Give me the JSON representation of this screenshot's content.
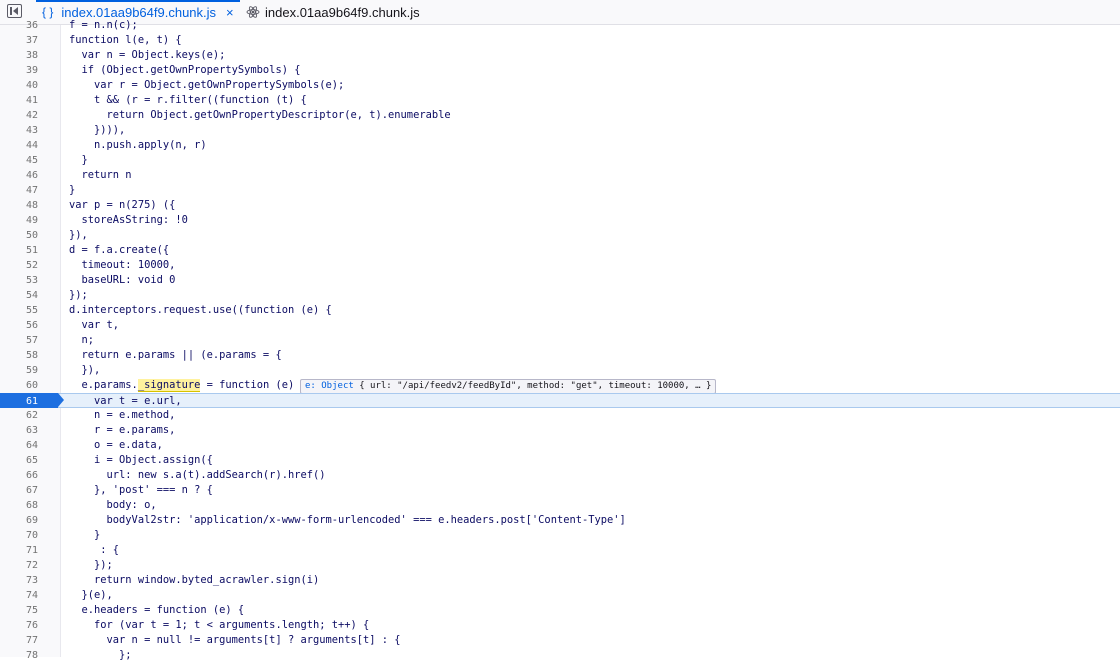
{
  "tabs": [
    {
      "label": "index.01aa9b64f9.chunk.js",
      "icon": "braces-icon",
      "active": true,
      "close": "×"
    },
    {
      "label": "index.01aa9b64f9.chunk.js",
      "icon": "react-icon",
      "active": false
    }
  ],
  "braces_glyph": "{ }",
  "paused_line": "61",
  "preview": {
    "param": "e:",
    "type": "Object",
    "body": "{ url: \"/api/feedv2/feedById\", method: \"get\", timeout: 10000, … }"
  },
  "lines": [
    {
      "n": "36",
      "code": "f = n.n(c);"
    },
    {
      "n": "37",
      "code": "function l(e, t) {"
    },
    {
      "n": "38",
      "code": "  var n = Object.keys(e);"
    },
    {
      "n": "39",
      "code": "  if (Object.getOwnPropertySymbols) {"
    },
    {
      "n": "40",
      "code": "    var r = Object.getOwnPropertySymbols(e);"
    },
    {
      "n": "41",
      "code": "    t && (r = r.filter((function (t) {"
    },
    {
      "n": "42",
      "code": "      return Object.getOwnPropertyDescriptor(e, t).enumerable"
    },
    {
      "n": "43",
      "code": "    }))),"
    },
    {
      "n": "44",
      "code": "    n.push.apply(n, r)"
    },
    {
      "n": "45",
      "code": "  }"
    },
    {
      "n": "46",
      "code": "  return n"
    },
    {
      "n": "47",
      "code": "}"
    },
    {
      "n": "48",
      "code": "var p = n(275) ({"
    },
    {
      "n": "49",
      "code": "  storeAsString: !0"
    },
    {
      "n": "50",
      "code": "}),"
    },
    {
      "n": "51",
      "code": "d = f.a.create({"
    },
    {
      "n": "52",
      "code": "  timeout: 10000,"
    },
    {
      "n": "53",
      "code": "  baseURL: void 0"
    },
    {
      "n": "54",
      "code": "});"
    },
    {
      "n": "55",
      "code": "d.interceptors.request.use((function (e) {"
    },
    {
      "n": "56",
      "code": "  var t,"
    },
    {
      "n": "57",
      "code": "  n;"
    },
    {
      "n": "58",
      "code": "  return e.params || (e.params = {"
    },
    {
      "n": "59",
      "code": "  }),"
    },
    {
      "n": "60",
      "code_pre": "  e.params.",
      "code_hl": "_signature",
      "code_post": " = function (e) {"
    },
    {
      "n": "61",
      "code": "    var t = e.url,"
    },
    {
      "n": "62",
      "code": "    n = e.method,"
    },
    {
      "n": "63",
      "code": "    r = e.params,"
    },
    {
      "n": "64",
      "code": "    o = e.data,"
    },
    {
      "n": "65",
      "code": "    i = Object.assign({"
    },
    {
      "n": "66",
      "code": "      url: new s.a(t).addSearch(r).href()"
    },
    {
      "n": "67",
      "code": "    }, 'post' === n ? {"
    },
    {
      "n": "68",
      "code": "      body: o,"
    },
    {
      "n": "69",
      "code": "      bodyVal2str: 'application/x-www-form-urlencoded' === e.headers.post['Content-Type']"
    },
    {
      "n": "70",
      "code": "    }"
    },
    {
      "n": "71",
      "code": "     : {"
    },
    {
      "n": "72",
      "code": "    });"
    },
    {
      "n": "73",
      "code": "    return window.byted_acrawler.sign(i)"
    },
    {
      "n": "74",
      "code": "  }(e),"
    },
    {
      "n": "75",
      "code": "  e.headers = function (e) {"
    },
    {
      "n": "76",
      "code": "    for (var t = 1; t < arguments.length; t++) {"
    },
    {
      "n": "77",
      "code": "      var n = null != arguments[t] ? arguments[t] : {"
    },
    {
      "n": "78",
      "code": "        };"
    }
  ]
}
